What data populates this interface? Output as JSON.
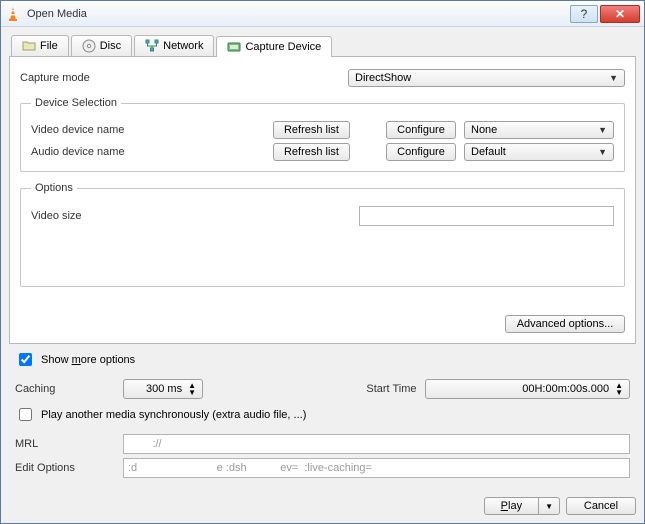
{
  "window": {
    "title": "Open Media"
  },
  "tabs": {
    "file": "File",
    "disc": "Disc",
    "network": "Network",
    "capture": "Capture Device"
  },
  "capture": {
    "mode_label": "Capture mode",
    "mode_value": "DirectShow",
    "device_selection_legend": "Device Selection",
    "video_device_label": "Video device name",
    "audio_device_label": "Audio device name",
    "refresh_label": "Refresh list",
    "configure_label": "Configure",
    "video_device_value": "None",
    "audio_device_value": "Default",
    "options_legend": "Options",
    "video_size_label": "Video size",
    "video_size_value": "",
    "advanced_label": "Advanced options..."
  },
  "more": {
    "show_more_label": "Show more options",
    "caching_label": "Caching",
    "caching_value": "300 ms",
    "start_time_label": "Start Time",
    "start_time_value": "00H:00m:00s.000",
    "play_another_label": "Play another media synchronously (extra audio file, ...)",
    "mrl_label": "MRL",
    "mrl_value": "        ://",
    "edit_options_label": "Edit Options",
    "edit_options_value": ":d                          e :dsh           ev=  :live-caching="
  },
  "footer": {
    "play_label": "Play",
    "cancel_label": "Cancel"
  }
}
